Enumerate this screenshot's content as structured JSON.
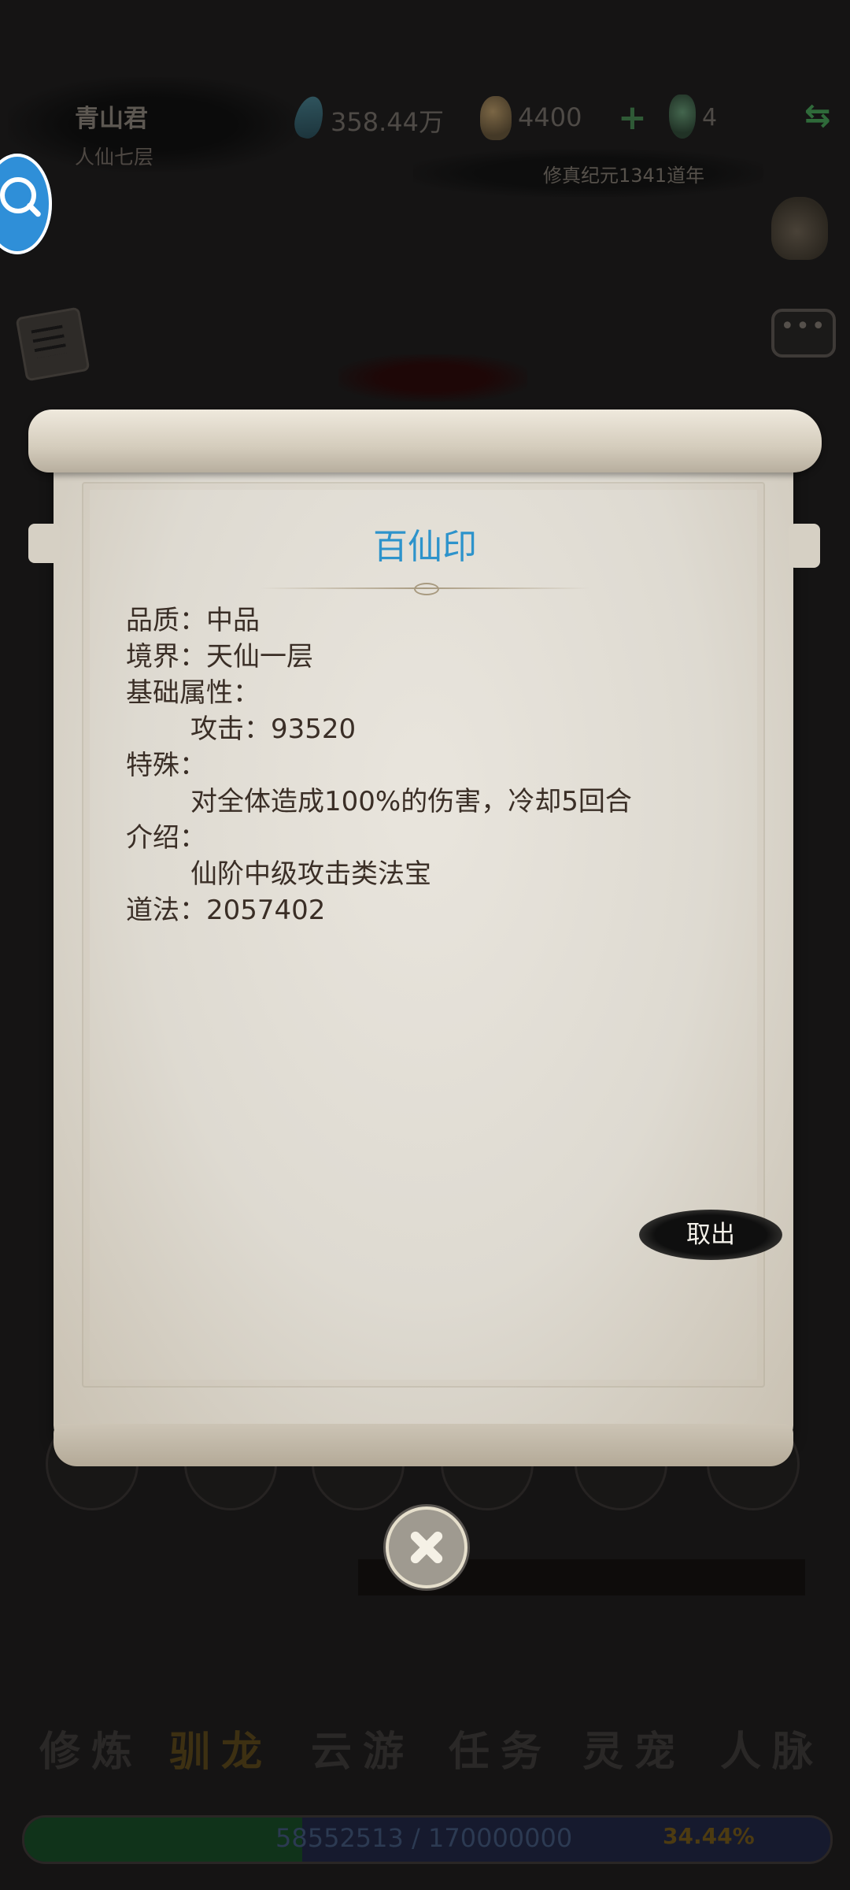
{
  "header": {
    "player_name": "青山君",
    "player_rank": "人仙七层",
    "spirit_stones": "358.44万",
    "gold": "4400",
    "jade": "4",
    "era": "修真纪元1341道年"
  },
  "nav": {
    "items": [
      "修炼",
      "驯龙",
      "云游",
      "任务",
      "灵宠",
      "人脉"
    ],
    "active": "驯龙"
  },
  "progress": {
    "text": "58552513 / 170000000",
    "percent_label": "34.44%",
    "value": 0.3444
  },
  "item_dialog": {
    "title": "百仙印",
    "quality_label": "品质：中品",
    "realm_label": "境界：天仙一层",
    "base_attr_heading": "基础属性：",
    "attack_line": "攻击：93520",
    "special_heading": "特殊：",
    "special_text": "对全体造成100%的伤害，冷却5回合",
    "intro_heading": "介绍：",
    "intro_text": "仙阶中级攻击类法宝",
    "dao_line": "道法：2057402",
    "take_out_label": "取出"
  },
  "colors": {
    "title_blue": "#2d93cb",
    "body_text": "#3a2e26",
    "background": "#151414",
    "search_fab": "#2f8fd8"
  },
  "icons": [
    "search-icon",
    "close-icon",
    "chat-icon",
    "book-icon",
    "bag-icon",
    "swap-icon",
    "gem-icon",
    "coin-icon",
    "jade-icon"
  ]
}
